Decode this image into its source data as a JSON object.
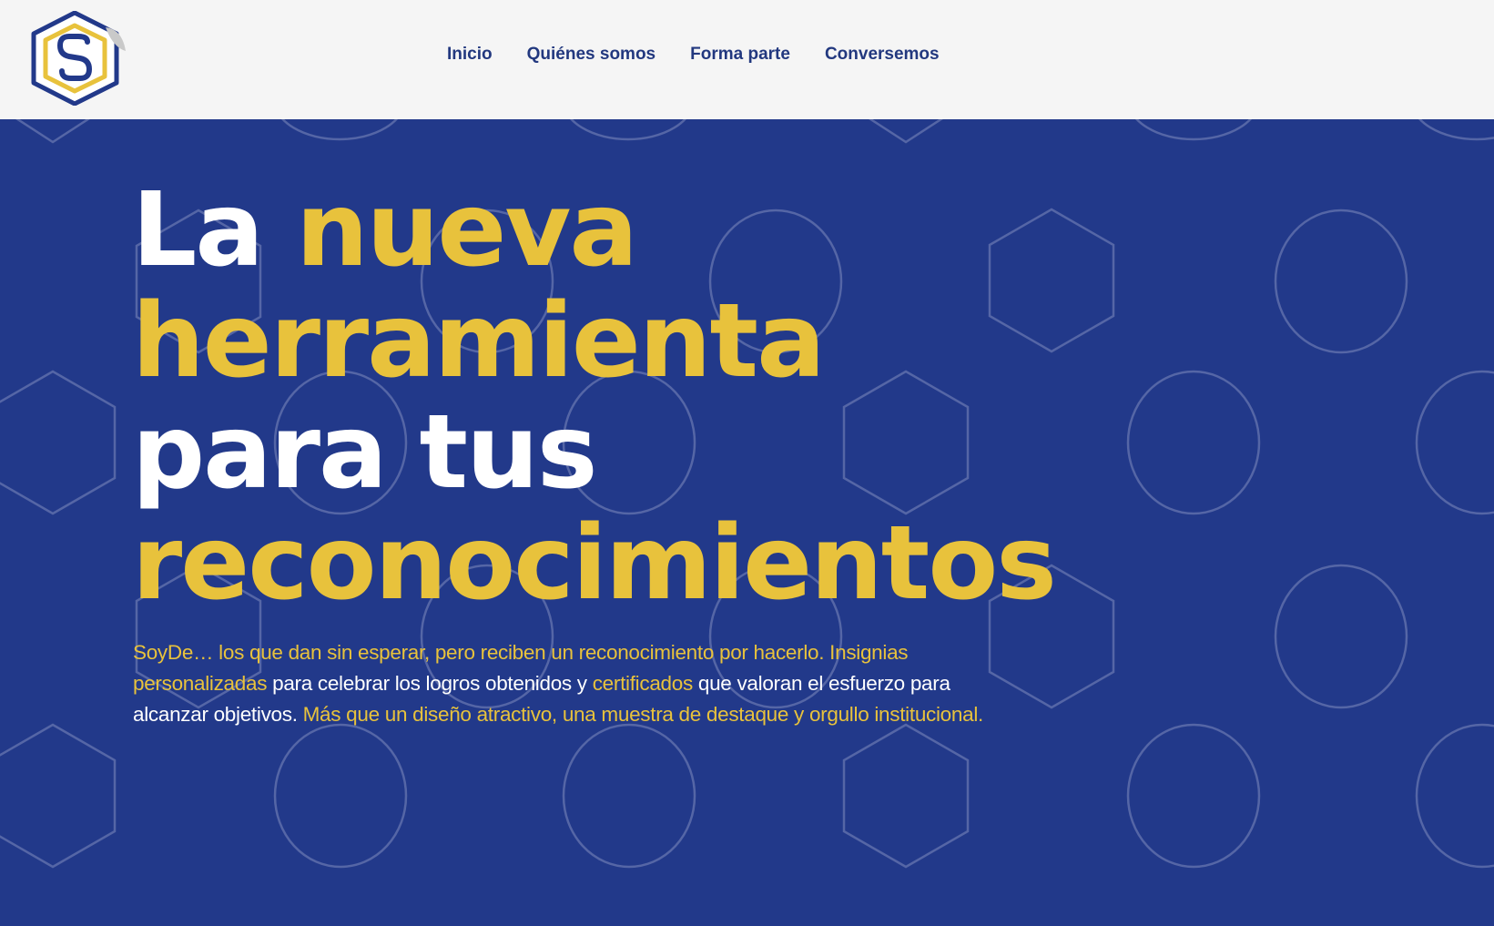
{
  "colors": {
    "header_bg": "#f5f5f5",
    "hero_bg": "#22398a",
    "nav_text": "#22387f",
    "accent_yellow": "#e8c23c",
    "text_white": "#ffffff",
    "pattern_stroke": "#5566a6"
  },
  "logo": {
    "icon": "soyde-logo-icon"
  },
  "nav": {
    "items": [
      {
        "label": "Inicio"
      },
      {
        "label": "Quiénes somos"
      },
      {
        "label": "Forma parte"
      },
      {
        "label": "Conversemos"
      }
    ]
  },
  "hero": {
    "headline": {
      "part1": "La ",
      "part2": "nueva",
      "part3": "herramienta",
      "part4": "para tus",
      "part5": "reconocimientos"
    },
    "description": {
      "seg1": "SoyDe… los que dan sin esperar, pero reciben un reconocimiento por hacerlo. Insignias personalizadas",
      "seg2": " para celebrar los logros obtenidos y ",
      "seg3": "certificados",
      "seg4": " que valoran el esfuerzo para alcanzar objetivos. ",
      "seg5": "Más que un diseño atractivo, una muestra de destaque y orgullo institucional."
    }
  }
}
